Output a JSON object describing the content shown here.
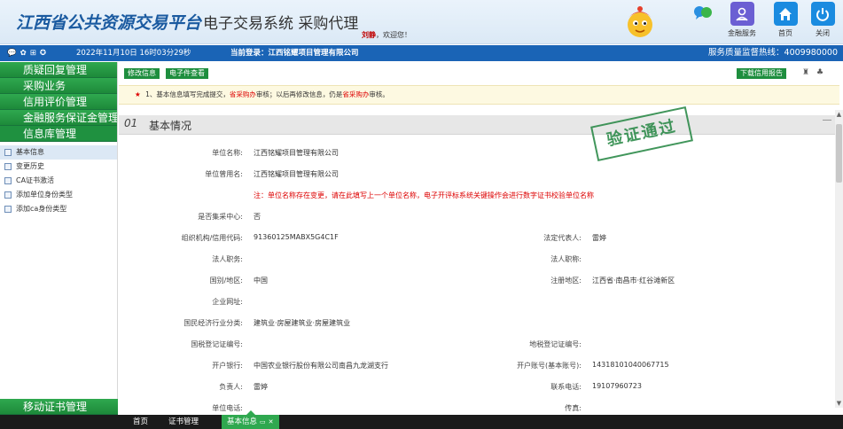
{
  "header": {
    "title_main": "江西省公共资源交易平台",
    "title_sys": "电子交易系统 采购代理",
    "greeting_user": "刘静",
    "greeting_suffix": "，欢迎您！",
    "buttons": [
      {
        "label": "金融服务",
        "icon": "finance-icon",
        "color": "#6b5fd3"
      },
      {
        "label": "首页",
        "icon": "home-icon",
        "color": "#1a8be0"
      },
      {
        "label": "关闭",
        "icon": "power-icon",
        "color": "#1a8be0"
      }
    ]
  },
  "infobar": {
    "datetime": "2022年11月10日 16时03分29秒",
    "login_label": "当前登录：",
    "login_company": "江西铭耀项目管理有限公司",
    "hotline": "服务质量监督热线：4009980000"
  },
  "sidebar": {
    "menu": [
      "质疑回复管理",
      "采购业务",
      "信用评价管理",
      "金融服务保证金管理",
      "信息库管理"
    ],
    "active_menu_prefix": "4",
    "sub_items": [
      "基本信息",
      "变更历史",
      "CA证书激活",
      "添加单位身份类型",
      "添加ca身份类型"
    ],
    "bottom_menu": "移动证书管理"
  },
  "toolbar": {
    "edit_label": "修改信息",
    "view_label": "电子件查看",
    "download_label": "下载信用报告"
  },
  "notice": {
    "star": "★",
    "p1": " 1、基本信息填写完成提交，",
    "r1": "省采购办",
    "p2": "审核；以后再修改信息，仍是",
    "r2": "省采购办",
    "p3": "审核。"
  },
  "section": {
    "num": "01",
    "title": "基本情况"
  },
  "stamp": "验证通过",
  "form": {
    "unit_name_label": "单位名称:",
    "unit_name": "江西铭耀项目管理有限公司",
    "former_name_label": "单位曾用名:",
    "former_name": "江西铭耀项目管理有限公司",
    "warning": "注：单位名称存在变更，请在此填写上一个单位名称，电子开评标系统关键操作会进行数字证书校验单位名称",
    "central_label": "是否集采中心:",
    "central": "否",
    "credit_code_label": "组织机构/信用代码:",
    "credit_code": "91360125MABX5G4C1F",
    "legal_rep_label": "法定代表人:",
    "legal_rep": "雷婷",
    "legal_post_label": "法人职务:",
    "legal_title_label": "法人职称:",
    "country_label": "国别/地区:",
    "country": "中国",
    "reg_area_label": "注册地区:",
    "reg_area": "江西省·南昌市·红谷滩新区",
    "website_label": "企业网址:",
    "industry_label": "国民经济行业分类:",
    "industry": "建筑业·房屋建筑业·房屋建筑业",
    "national_tax_label": "国税登记证编号:",
    "local_tax_label": "地税登记证编号:",
    "bank_label": "开户银行:",
    "bank": "中国农业银行股份有限公司南昌九龙湖支行",
    "account_label": "开户账号(基本账号):",
    "account": "14318101040067715",
    "owner_label": "负责人:",
    "owner": "雷婷",
    "contact_phone_label": "联系电话:",
    "contact_phone": "19107960723",
    "unit_phone_label": "单位电话:",
    "fax_label": "传真:"
  },
  "bottom_tabs": {
    "home": "首页",
    "cert": "证书管理",
    "basic": "基本信息"
  }
}
